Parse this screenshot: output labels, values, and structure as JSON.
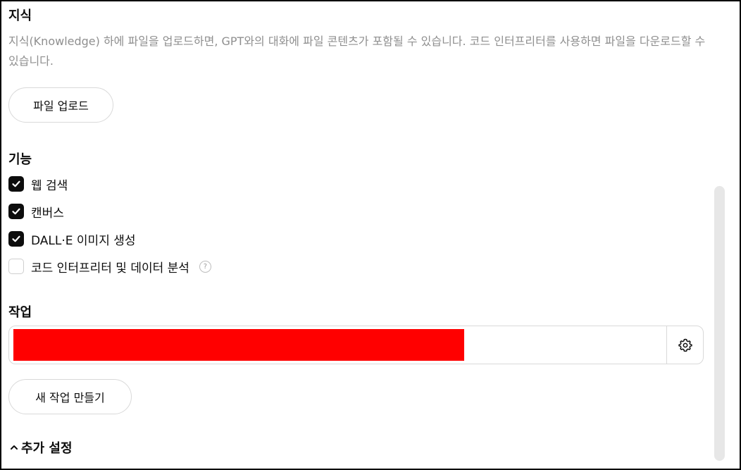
{
  "knowledge": {
    "title": "지식",
    "description": "지식(Knowledge) 하에 파일을 업로드하면, GPT와의 대화에 파일 콘텐츠가 포함될 수 있습니다. 코드 인터프리터를 사용하면 파일을 다운로드할 수 있습니다.",
    "upload_button": "파일 업로드"
  },
  "capabilities": {
    "title": "기능",
    "items": [
      {
        "label": "웹 검색",
        "checked": true
      },
      {
        "label": "캔버스",
        "checked": true
      },
      {
        "label": "DALL·E 이미지 생성",
        "checked": true
      },
      {
        "label": "코드 인터프리터 및 데이터 분석",
        "checked": false
      }
    ],
    "help_glyph": "?"
  },
  "actions": {
    "title": "작업",
    "new_action_button": "새 작업 만들기",
    "redaction_color": "#ff0000"
  },
  "advanced": {
    "label": "추가 설정",
    "chevron": "^"
  },
  "colors": {
    "text": "#0d0d0d",
    "muted": "#8f8f8f",
    "border": "#d9d9d9",
    "checked_fill": "#0d0d0d"
  },
  "icons": {
    "check": "check-icon",
    "gear": "gear-icon",
    "help": "help-circle-icon",
    "chevron_up": "chevron-up-icon"
  }
}
